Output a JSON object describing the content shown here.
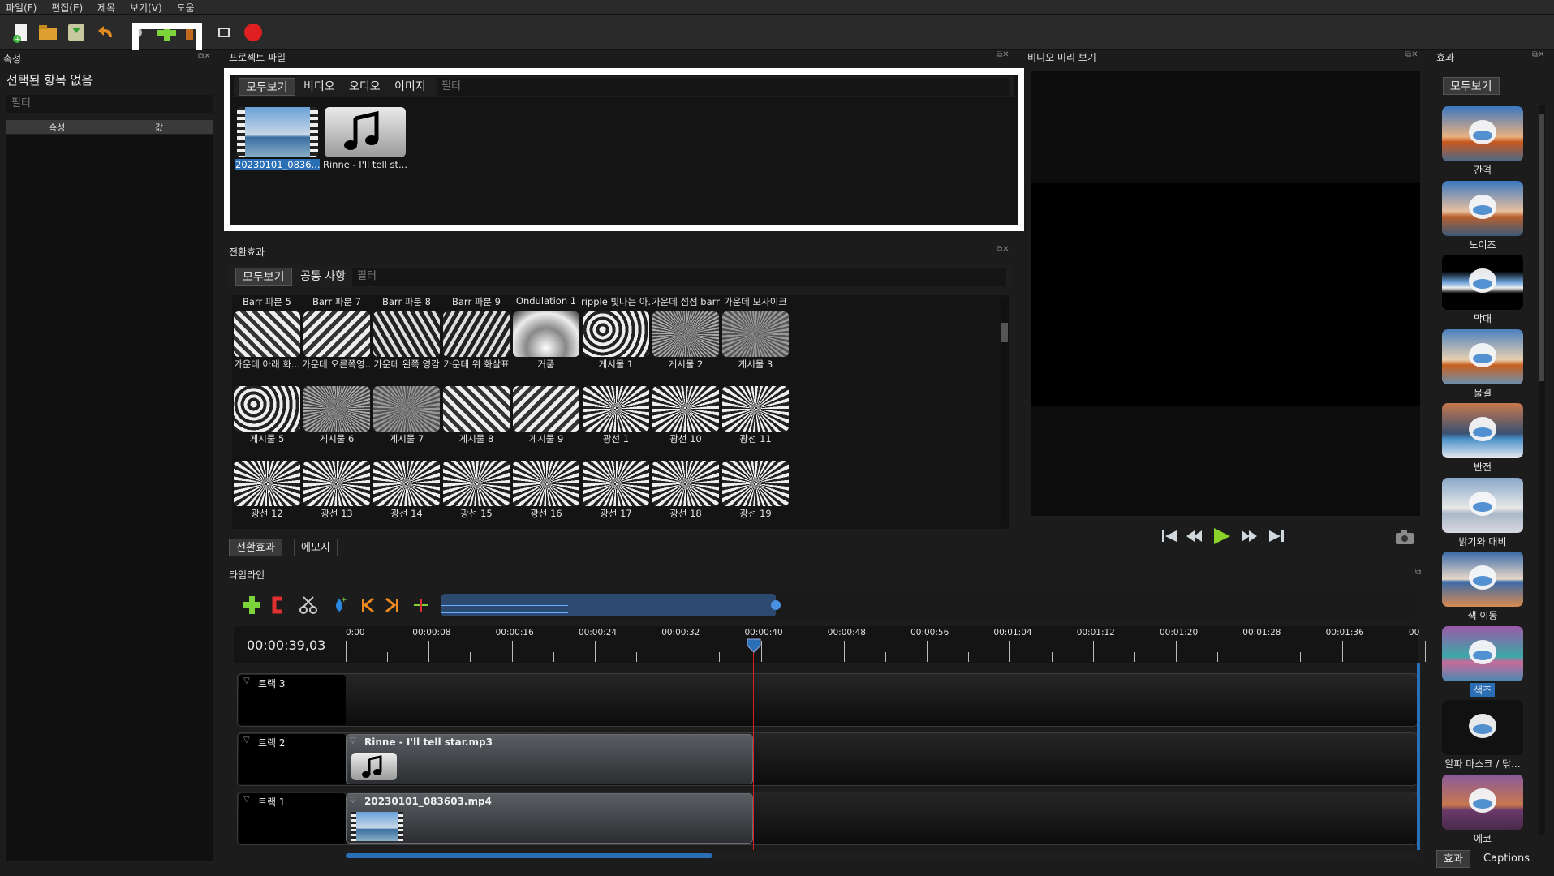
{
  "menu": [
    "파일(F)",
    "편집(E)",
    "제목",
    "보기(V)",
    "도움"
  ],
  "properties": {
    "title": "속성",
    "no_selection": "선택된 항목 없음",
    "filter_placeholder": "필터",
    "col_property": "속성",
    "col_value": "값"
  },
  "project_files": {
    "title": "프로젝트 파일",
    "tabs": [
      "모두보기",
      "비디오",
      "오디오",
      "이미지"
    ],
    "filter_placeholder": "필터",
    "files": [
      {
        "name": "20230101_0836...",
        "icon": "video-film-icon"
      },
      {
        "name": "Rinne - I'll tell st...",
        "icon": "music-note-icon"
      }
    ]
  },
  "transitions": {
    "title": "전환효과",
    "tabs": [
      "모두보기",
      "공통 사항"
    ],
    "filter_placeholder": "필터",
    "header_labels": [
      "Barr 파분 5",
      "Barr 파분 7",
      "Barr 파분 8",
      "Barr 파분 9",
      "Ondulation 1",
      "ripple 빛나는 아...",
      "가운데 섬점 barr",
      "가운데 모사이크"
    ],
    "rows": [
      [
        "가운데 아래 화...",
        "가운데 오른쪽영...",
        "가운데 왼쪽 영감",
        "가운데 위 화살표",
        "거품",
        "게시물 1",
        "게시물 2",
        "게시물 3"
      ],
      [
        "게시물 5",
        "게시물 6",
        "게시물 7",
        "게시물 8",
        "게시물 9",
        "광선 1",
        "광선 10",
        "광선 11"
      ],
      [
        "광선 12",
        "광선 13",
        "광선 14",
        "광선 15",
        "광선 16",
        "광선 17",
        "광선 18",
        "광선 19"
      ]
    ],
    "bottom_tabs": [
      "전환효과",
      "에모지"
    ]
  },
  "preview": {
    "title": "비디오 미리 보기"
  },
  "effects": {
    "title": "효과",
    "tab": "모두보기",
    "items": [
      "간격",
      "노이즈",
      "막대",
      "물결",
      "반전",
      "밝기와 대비",
      "색 이동",
      "색조",
      "알파 마스크 / 닦...",
      "에코"
    ],
    "bottom_tabs": [
      "효과",
      "Captions"
    ]
  },
  "timeline": {
    "title": "타임라인",
    "timecode": "00:00:39,03",
    "ruler": [
      "0:00",
      "00:00:08",
      "00:00:16",
      "00:00:24",
      "00:00:32",
      "00:00:40",
      "00:00:48",
      "00:00:56",
      "00:01:04",
      "00:01:12",
      "00:01:20",
      "00:01:28",
      "00:01:36",
      "00"
    ],
    "tracks": [
      {
        "name": "트랙 3",
        "clip": ""
      },
      {
        "name": "트랙 2",
        "clip": "Rinne - I'll tell star.mp3"
      },
      {
        "name": "트랙 1",
        "clip": "20230101_083603.mp4"
      }
    ]
  },
  "colors": {
    "accent": "#2a6fb5",
    "playhead": "#cc2222",
    "highlight": "#ffffff"
  }
}
